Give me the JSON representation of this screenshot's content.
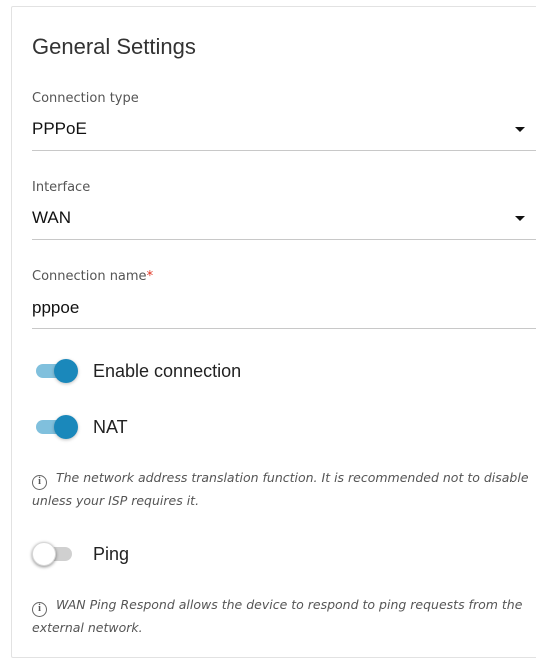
{
  "section": {
    "title": "General Settings"
  },
  "connection_type": {
    "label": "Connection type",
    "value": "PPPoE",
    "icon": "chevron-down-icon"
  },
  "interface": {
    "label": "Interface",
    "value": "WAN",
    "icon": "chevron-down-icon"
  },
  "connection_name": {
    "label": "Connection name",
    "required_mark": "*",
    "value": "pppoe"
  },
  "toggles": {
    "enable_connection": {
      "label": "Enable connection",
      "state": "on"
    },
    "nat": {
      "label": "NAT",
      "state": "on",
      "info_icon": "info-icon",
      "hint": "The network address translation function. It is recommended not to disable unless your ISP requires it."
    },
    "ping": {
      "label": "Ping",
      "state": "off",
      "info_icon": "info-icon",
      "hint": "WAN Ping Respond allows the device to respond to ping requests from the external network."
    }
  },
  "colors": {
    "accent": "#1a88bb",
    "accent_track": "#80c0dd",
    "required": "#e0301e"
  }
}
